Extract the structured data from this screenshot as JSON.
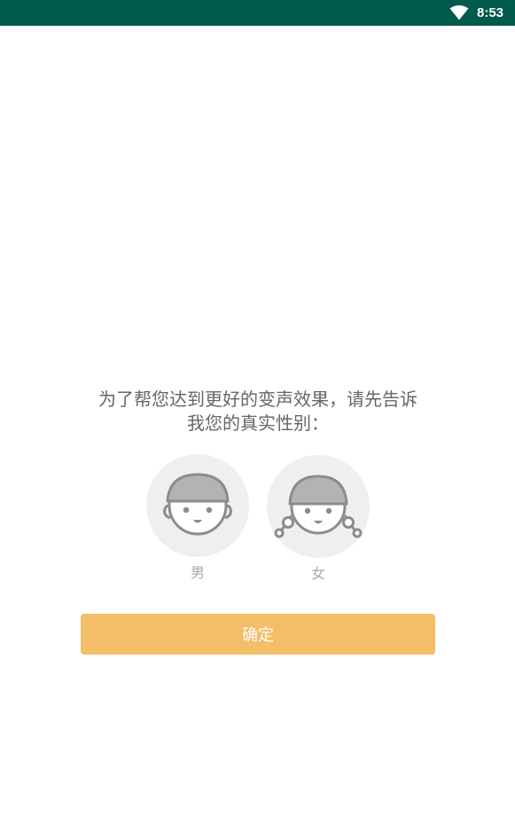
{
  "status_bar": {
    "time": "8:53",
    "background": "#005a4c",
    "icons": [
      "wifi-icon"
    ]
  },
  "prompt": {
    "line1": "为了帮您达到更好的变声效果，请先告诉",
    "line2": "我您的真实性别："
  },
  "genders": [
    {
      "label": "男",
      "icon": "boy-avatar-icon"
    },
    {
      "label": "女",
      "icon": "girl-avatar-icon"
    }
  ],
  "confirm_button": {
    "label": "确定",
    "color": "#f3be67"
  }
}
